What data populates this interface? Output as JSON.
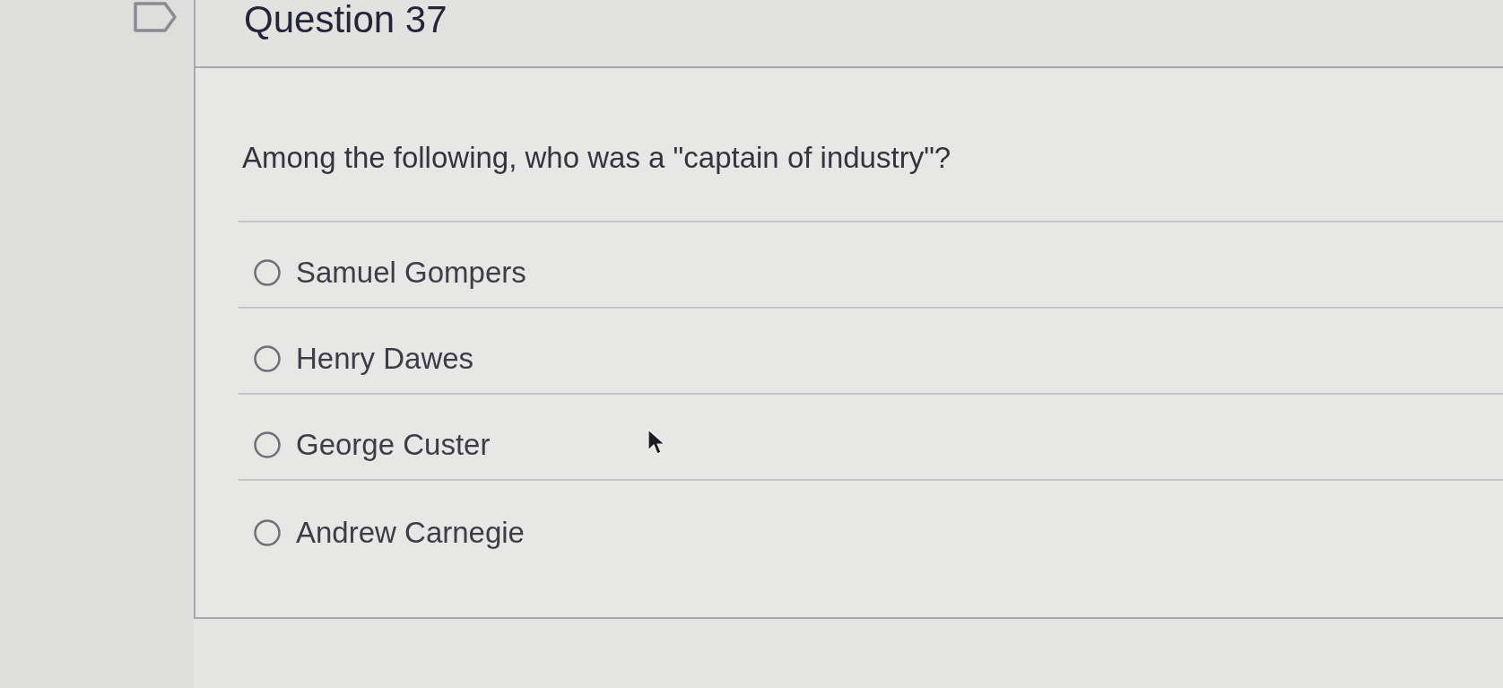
{
  "question": {
    "title": "Question 37",
    "flagged": false
  },
  "prompt": "Among the following, who was a \"captain of industry\"?",
  "options": [
    {
      "label": "Samuel Gompers",
      "selected": false
    },
    {
      "label": "Henry Dawes",
      "selected": false
    },
    {
      "label": "George Custer",
      "selected": false
    },
    {
      "label": "Andrew Carnegie",
      "selected": false
    }
  ]
}
